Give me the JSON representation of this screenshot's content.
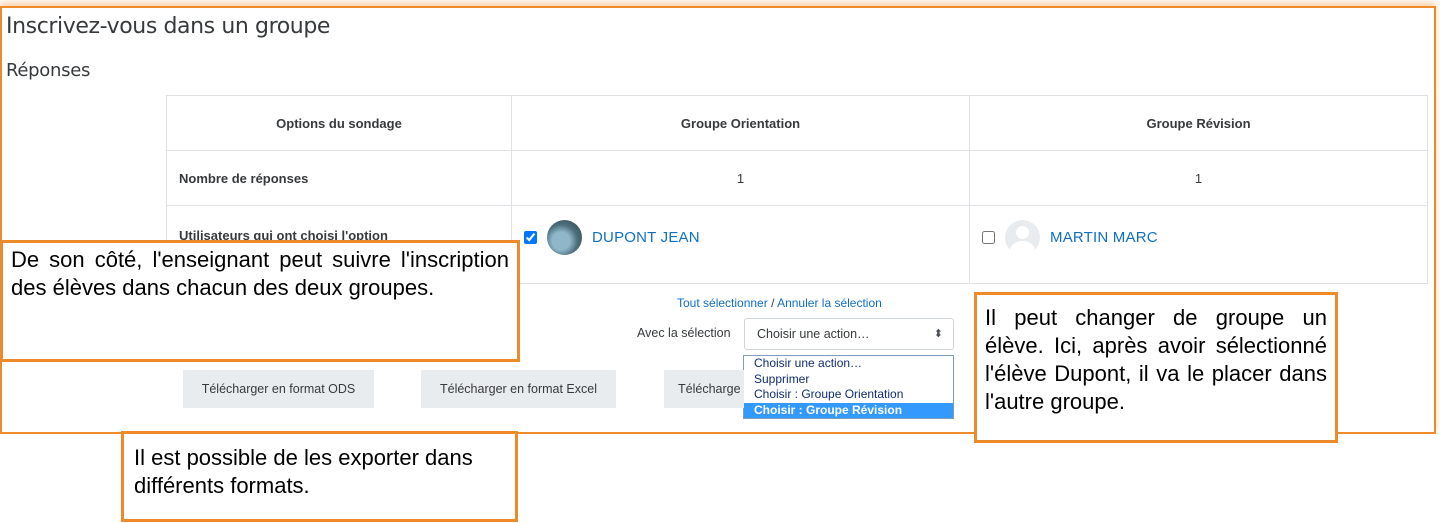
{
  "page": {
    "title": "Inscrivez-vous dans un groupe",
    "section": "Réponses"
  },
  "table": {
    "headers": [
      "Options du sondage",
      "Groupe Orientation",
      "Groupe Révision"
    ],
    "rows": {
      "count_label": "Nombre de réponses",
      "count_values": [
        "1",
        "1"
      ],
      "users_label": "Utilisateurs qui ont choisi l'option"
    },
    "users": [
      {
        "name": "DUPONT JEAN",
        "checked": true
      },
      {
        "name": "MARTIN MARC",
        "checked": false
      }
    ]
  },
  "selection": {
    "select_all": "Tout sélectionner",
    "separator": " / ",
    "deselect": "Annuler la sélection",
    "with_selection_label": "Avec la sélection",
    "current_action": "Choisir une action…",
    "options": [
      "Choisir une action…",
      "Supprimer",
      "Choisir : Groupe Orientation",
      "Choisir : Groupe Révision"
    ],
    "highlighted_option": "Choisir : Groupe Révision"
  },
  "downloads": {
    "ods": "Télécharger en format ODS",
    "excel": "Télécharger en format Excel",
    "text": "Télécharge"
  },
  "callouts": {
    "teacher": "De son côté, l'enseignant peut suivre l'inscription des élèves dans chacun des deux groupes.",
    "export": "Il est possible de les exporter dans différents formats.",
    "change": "Il peut changer de groupe un élève. Ici, après avoir sélectionné l'élève Dupont, il va le placer dans l'autre groupe."
  },
  "colors": {
    "accent": "#ed8a2a",
    "link": "#0f6fc5",
    "highlight": "#3399ff"
  }
}
